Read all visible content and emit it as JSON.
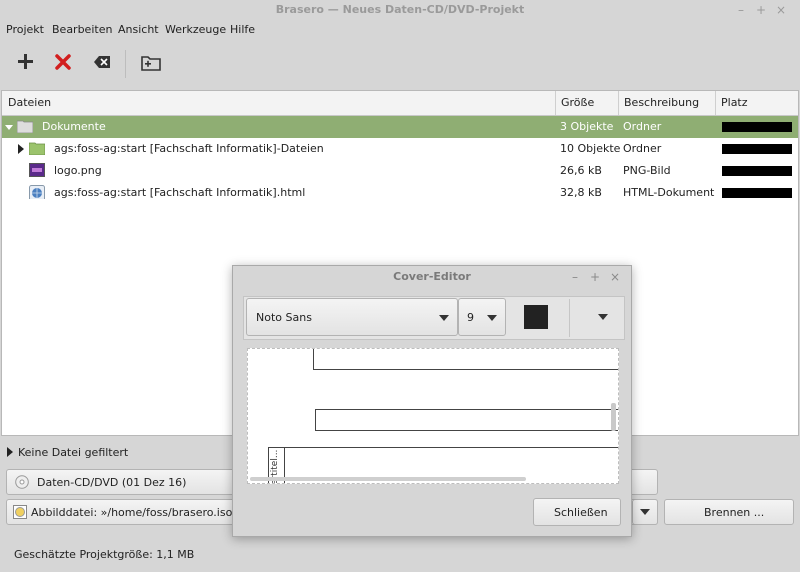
{
  "window": {
    "title": "Brasero — Neues Daten-CD/DVD-Projekt",
    "minimize": "–",
    "maximize": "+",
    "close": "×"
  },
  "menu": {
    "items": [
      "Projekt",
      "Bearbeiten",
      "Ansicht",
      "Werkzeuge",
      "Hilfe"
    ]
  },
  "toolbar": {
    "add_icon": "plus-icon",
    "remove_icon": "red-x-icon",
    "clear_icon": "backspace-icon",
    "new_folder_icon": "folder-add-icon"
  },
  "table": {
    "headers": [
      "Dateien",
      "Größe",
      "Beschreibung",
      "Platz"
    ],
    "rows": [
      {
        "name": "Dokumente",
        "size": "3 Objekte",
        "desc": "Ordner"
      },
      {
        "name": "ags:foss-ag:start [Fachschaft Informatik]-Dateien",
        "size": "10 Objekte",
        "desc": "Ordner"
      },
      {
        "name": "logo.png",
        "size": "26,6 kB",
        "desc": "PNG-Bild"
      },
      {
        "name": "ags:foss-ag:start [Fachschaft Informatik].html",
        "size": "32,8 kB",
        "desc": "HTML-Dokument"
      }
    ]
  },
  "filter": {
    "label": "Keine Datei gefiltert"
  },
  "disc": {
    "label": "Daten-CD/DVD (01 Dez 16)"
  },
  "image_file": {
    "label": "Abbilddatei: »/home/foss/brasero.iso«"
  },
  "burn": {
    "label": "Brennen ..."
  },
  "status": {
    "size": "Geschätzte Projektgröße: 1,1 MB"
  },
  "cover_editor": {
    "title": "Cover-Editor",
    "minimize": "–",
    "maximize": "+",
    "close": "×",
    "font": "Noto Sans",
    "font_size": "9",
    "color": "#222222",
    "side_label": "ertitel...",
    "close_button": "Schließen"
  },
  "colors": {
    "selection": "#8fae73",
    "delete_red": "#d21e1e"
  }
}
